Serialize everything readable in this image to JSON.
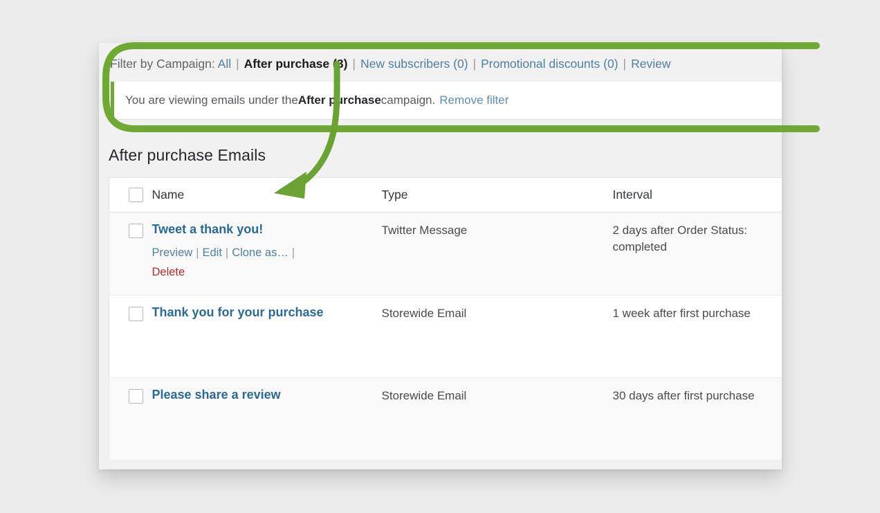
{
  "filter_bar": {
    "label": "Filter by Campaign:",
    "separator": "|",
    "items": [
      {
        "label": "All",
        "state": "link"
      },
      {
        "label": "After purchase (3)",
        "state": "current"
      },
      {
        "label": "New subscribers (0)",
        "state": "link"
      },
      {
        "label": "Promotional discounts (0)",
        "state": "link"
      },
      {
        "label": "Review",
        "state": "link"
      }
    ]
  },
  "notice": {
    "text_before": "You are viewing emails under the ",
    "campaign_name": "After purchase",
    "text_after": " campaign.",
    "remove_filter_label": "Remove filter"
  },
  "page": {
    "title": "After purchase Emails"
  },
  "table": {
    "columns": [
      {
        "key": "checkbox",
        "label": ""
      },
      {
        "key": "name",
        "label": "Name"
      },
      {
        "key": "type",
        "label": "Type"
      },
      {
        "key": "interval",
        "label": "Interval"
      }
    ],
    "rows": [
      {
        "name": "Tweet a thank you!",
        "type": "Twitter Message",
        "interval": "2 days after Order Status: completed",
        "actions": [
          {
            "label": "Preview",
            "kind": "link"
          },
          {
            "label": "Edit",
            "kind": "link"
          },
          {
            "label": "Clone as…",
            "kind": "link"
          },
          {
            "label": "Delete",
            "kind": "delete"
          }
        ]
      },
      {
        "name": "Thank you for your purchase",
        "type": "Storewide Email",
        "interval": "1 week after first purchase",
        "actions": []
      },
      {
        "name": "Please share a review",
        "type": "Storewide Email",
        "interval": "30 days after first purchase",
        "actions": []
      }
    ]
  },
  "annotation": {
    "highlight_color": "#6fa832",
    "arrow_color": "#6aa333",
    "shape": "rounded-rectangle-with-curved-arrow"
  },
  "colors": {
    "page_background": "#ececec",
    "card_background": "#f1f1f1",
    "link": "#4f7f9e",
    "title_link": "#2a6a94",
    "delete_link": "#b32d2e",
    "accent_green": "#6fa832",
    "row_alt": "#f9f9f9"
  }
}
